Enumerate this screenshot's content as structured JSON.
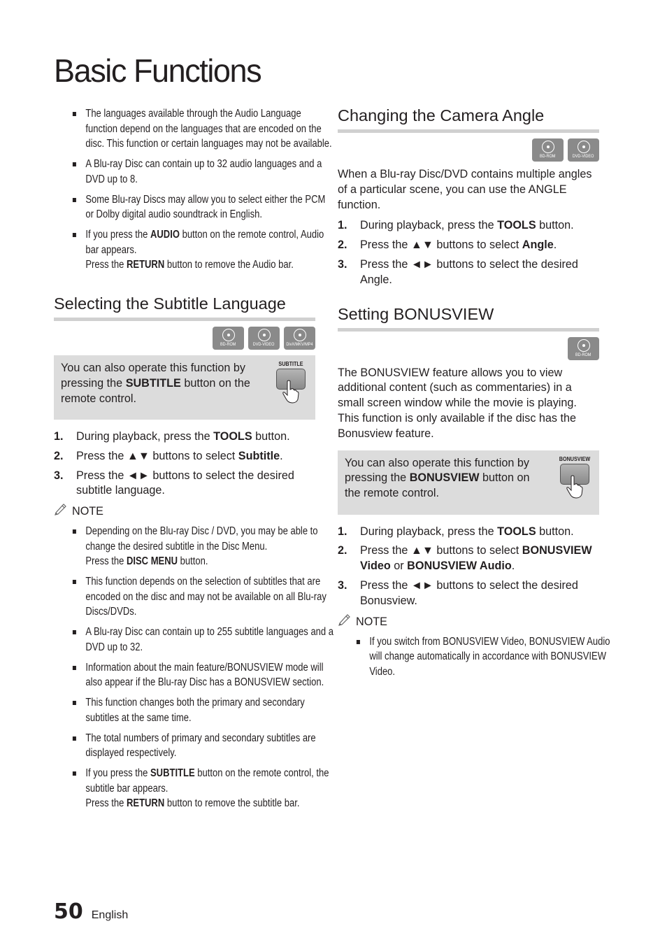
{
  "page": {
    "title": "Basic Functions",
    "page_number": "50",
    "language": "English"
  },
  "audio_notes": [
    {
      "parts": [
        {
          "t": "The languages available through the Audio Language function depend on the languages that are encoded on the disc. This function or certain languages may not be available."
        }
      ]
    },
    {
      "parts": [
        {
          "t": "A Blu-ray Disc can contain up to 32 audio languages and a DVD up to 8."
        }
      ]
    },
    {
      "parts": [
        {
          "t": "Some Blu-ray Discs may allow you to select either the PCM or Dolby digital audio soundtrack in English."
        }
      ]
    },
    {
      "parts": [
        {
          "t": "If you press the "
        },
        {
          "b": "AUDIO"
        },
        {
          "t": " button on the remote control, Audio bar appears."
        },
        {
          "br": true
        },
        {
          "t": "Press the "
        },
        {
          "b": "RETURN"
        },
        {
          "t": " button to remove the Audio bar."
        }
      ]
    }
  ],
  "subtitle": {
    "title": "Selecting the Subtitle Language",
    "disc_icons": [
      "BD-ROM",
      "DVD-VIDEO",
      "DivX/MKV/MP4"
    ],
    "tip": {
      "parts": [
        {
          "t": "You can also operate this function by pressing the "
        },
        {
          "b": "SUBTITLE"
        },
        {
          "t": " button on the remote control."
        }
      ],
      "remote_button_label": "SUBTITLE"
    },
    "steps": [
      {
        "num": "1.",
        "parts": [
          {
            "t": "During playback, press the "
          },
          {
            "b": "TOOLS"
          },
          {
            "t": " button."
          }
        ]
      },
      {
        "num": "2.",
        "parts": [
          {
            "t": "Press the ▲▼ buttons to select "
          },
          {
            "b": "Subtitle"
          },
          {
            "t": "."
          }
        ]
      },
      {
        "num": "3.",
        "parts": [
          {
            "t": "Press the ◄► buttons to select the desired subtitle language."
          }
        ]
      }
    ],
    "note_label": "NOTE",
    "notes": [
      {
        "parts": [
          {
            "t": "Depending on the Blu-ray Disc / DVD, you may be able to change the desired subtitle in the Disc Menu."
          },
          {
            "br": true
          },
          {
            "t": "Press the "
          },
          {
            "b": "DISC MENU"
          },
          {
            "t": " button."
          }
        ]
      },
      {
        "parts": [
          {
            "t": "This function depends on the selection of subtitles that are encoded on the disc and may not be available on all Blu-ray Discs/DVDs."
          }
        ]
      },
      {
        "parts": [
          {
            "t": "A Blu-ray Disc can contain up to 255 subtitle languages and a DVD up to 32."
          }
        ]
      },
      {
        "parts": [
          {
            "t": "Information about the main feature/BONUSVIEW mode will also appear if the Blu-ray Disc has a BONUSVIEW section."
          }
        ]
      },
      {
        "parts": [
          {
            "t": "This function changes both the primary and secondary subtitles at the same time."
          }
        ]
      },
      {
        "parts": [
          {
            "t": "The total numbers of primary and secondary subtitles are displayed respectively."
          }
        ]
      },
      {
        "parts": [
          {
            "t": "If you press the "
          },
          {
            "b": "SUBTITLE"
          },
          {
            "t": " button on the remote control, the subtitle bar appears."
          },
          {
            "br": true
          },
          {
            "t": "Press the "
          },
          {
            "b": "RETURN"
          },
          {
            "t": " button to remove the subtitle bar."
          }
        ]
      }
    ]
  },
  "angle": {
    "title": "Changing the Camera Angle",
    "disc_icons": [
      "BD-ROM",
      "DVD-VIDEO"
    ],
    "intro": "When a Blu-ray Disc/DVD contains multiple angles of a particular scene, you can use the ANGLE function.",
    "steps": [
      {
        "num": "1.",
        "parts": [
          {
            "t": "During playback, press the "
          },
          {
            "b": "TOOLS"
          },
          {
            "t": " button."
          }
        ]
      },
      {
        "num": "2.",
        "parts": [
          {
            "t": "Press the ▲▼ buttons to select "
          },
          {
            "b": "Angle"
          },
          {
            "t": "."
          }
        ]
      },
      {
        "num": "3.",
        "parts": [
          {
            "t": "Press the ◄► buttons to select the desired Angle."
          }
        ]
      }
    ]
  },
  "bonusview": {
    "title": "Setting BONUSVIEW",
    "disc_icons": [
      "BD-ROM"
    ],
    "intro": "The BONUSVIEW feature allows you to view additional content (such as commentaries) in a small screen window while the movie is playing. This function is only available if the disc has the Bonusview feature.",
    "tip": {
      "parts": [
        {
          "t": "You can also operate this function by pressing the "
        },
        {
          "b": "BONUSVIEW"
        },
        {
          "t": " button on the remote control."
        }
      ],
      "remote_button_label": "BONUSVIEW"
    },
    "steps": [
      {
        "num": "1.",
        "parts": [
          {
            "t": "During playback, press the "
          },
          {
            "b": "TOOLS"
          },
          {
            "t": " button."
          }
        ]
      },
      {
        "num": "2.",
        "parts": [
          {
            "t": "Press the ▲▼ buttons to select "
          },
          {
            "b": "BONUSVIEW Video"
          },
          {
            "t": " or "
          },
          {
            "b": "BONUSVIEW Audio"
          },
          {
            "t": "."
          }
        ]
      },
      {
        "num": "3.",
        "parts": [
          {
            "t": "Press the ◄► buttons to select the desired Bonusview."
          }
        ]
      }
    ],
    "note_label": "NOTE",
    "notes": [
      {
        "parts": [
          {
            "t": "If you switch from BONUSVIEW Video, BONUSVIEW Audio will change automatically in accordance with BONUSVIEW Video."
          }
        ]
      }
    ]
  }
}
